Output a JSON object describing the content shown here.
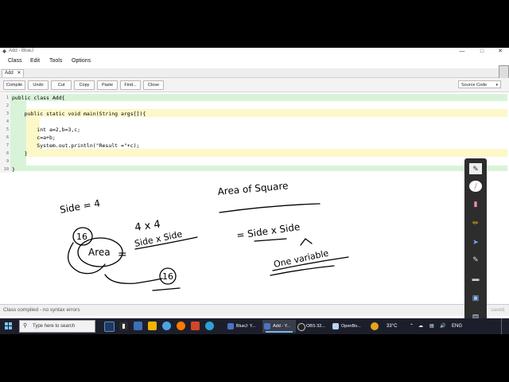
{
  "window": {
    "title": "Add - BlueJ",
    "minimize_glyph": "—",
    "maximize_glyph": "□",
    "close_glyph": "✕"
  },
  "menu": [
    "Class",
    "Edit",
    "Tools",
    "Options"
  ],
  "tab": {
    "label": "Add",
    "close_glyph": "✕"
  },
  "toolbar": {
    "buttons": [
      "Compile",
      "Undo",
      "Cut",
      "Copy",
      "Paste",
      "Find...",
      "Close"
    ],
    "view_select": "Source Code"
  },
  "code": {
    "lines": [
      "public class Add{",
      "",
      "    public static void main(String args[]){",
      "",
      "        int a=2,b=3,c;",
      "        c=a+b;",
      "        System.out.println(\"Result =\"+c);",
      "    }",
      "",
      "}"
    ],
    "line_numbers": [
      "1",
      "2",
      "3",
      "4",
      "5",
      "6",
      "7",
      "8",
      "9",
      "10"
    ]
  },
  "annotations": {
    "side_eq": "Side = 4",
    "sixteen_a": "16",
    "area_word": "Area",
    "equals_sign": "=",
    "four_by_four": "4 x 4",
    "side_by_side_left": "Side x Side",
    "sixteen_b": "16",
    "area_of_square": "Area of Square",
    "eq_side_by_side": "= Side x Side",
    "one_variable": "One variable"
  },
  "status": {
    "message": "Class compiled - no syntax errors",
    "saved": "saved"
  },
  "taskbar": {
    "search_placeholder": "Type here to search",
    "apps": [
      "BlueJ: Y...",
      "Add - Y...",
      "OBS 32...",
      "OpenBo..."
    ],
    "weather": "33°C",
    "language": "ENG"
  },
  "colors": {
    "class_block": "#d9f3d9",
    "method_block": "#fdf8c8",
    "keyword": "#7a1b6b",
    "string": "#0f6b0f",
    "taskbar": "#1c1f2b",
    "ink": "#000000"
  },
  "icons": {
    "start": "windows-start-icon",
    "search": "magnifier-icon",
    "pen_tools": [
      "pen-icon",
      "red-pen-icon",
      "eraser-icon",
      "highlighter-icon",
      "pointer-icon",
      "brush-icon",
      "line-icon",
      "screen-icon",
      "board-icon"
    ]
  }
}
